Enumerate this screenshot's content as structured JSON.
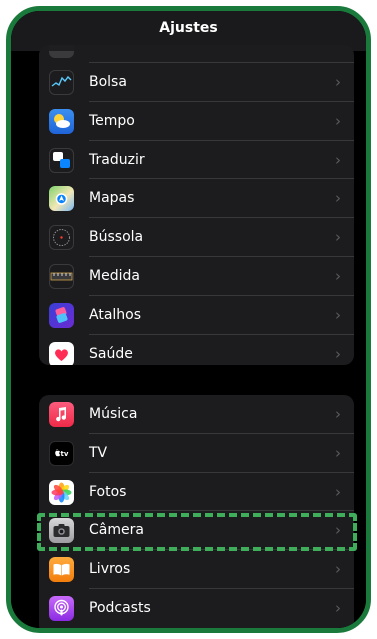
{
  "nav": {
    "title": "Ajustes"
  },
  "group1": [
    {
      "label": "Bolsa",
      "icon": "stocks-icon"
    },
    {
      "label": "Tempo",
      "icon": "weather-icon"
    },
    {
      "label": "Traduzir",
      "icon": "translate-icon"
    },
    {
      "label": "Mapas",
      "icon": "maps-icon"
    },
    {
      "label": "Bússola",
      "icon": "compass-icon"
    },
    {
      "label": "Medida",
      "icon": "measure-icon"
    },
    {
      "label": "Atalhos",
      "icon": "shortcuts-icon"
    },
    {
      "label": "Saúde",
      "icon": "health-icon"
    }
  ],
  "group2": [
    {
      "label": "Música",
      "icon": "music-icon"
    },
    {
      "label": "TV",
      "icon": "tv-icon",
      "icon_text": "tv"
    },
    {
      "label": "Fotos",
      "icon": "photos-icon"
    },
    {
      "label": "Câmera",
      "icon": "camera-icon",
      "highlighted": true
    },
    {
      "label": "Livros",
      "icon": "books-icon"
    },
    {
      "label": "Podcasts",
      "icon": "podcasts-icon"
    }
  ],
  "chevron": "›",
  "colors": {
    "frame": "#1a7a3c",
    "highlight": "#3fae5a",
    "group_bg": "#1c1c1e",
    "background": "#000000"
  }
}
